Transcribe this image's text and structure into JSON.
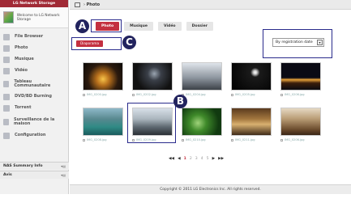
{
  "sidebar": {
    "brand": "LG Network Storage",
    "welcome": "Welcome to LG Network Storage",
    "items": [
      {
        "label": "File Browser",
        "icon": "folder-icon"
      },
      {
        "label": "Photo",
        "icon": "photo-icon"
      },
      {
        "label": "Musique",
        "icon": "music-icon"
      },
      {
        "label": "Vidéo",
        "icon": "video-icon"
      },
      {
        "label": "Tableau Communautaire",
        "icon": "board-icon"
      },
      {
        "label": "DVD/BD Burning",
        "icon": "disc-icon"
      },
      {
        "label": "Torrent",
        "icon": "torrent-icon"
      },
      {
        "label": "Surveillance de la maison",
        "icon": "camera-icon"
      },
      {
        "label": "Configuration",
        "icon": "gear-icon"
      }
    ],
    "nas_summary": "NAS Summary Info",
    "avis": "Avis"
  },
  "topbar": {
    "breadcrumb": "Photo"
  },
  "tabs": [
    {
      "label": "Photo",
      "active": true
    },
    {
      "label": "Musique",
      "active": false
    },
    {
      "label": "Vidéo",
      "active": false
    },
    {
      "label": "Dossier",
      "active": false
    }
  ],
  "slideshow_label": "Diaporama",
  "sort": {
    "selected": "By registration date"
  },
  "annotations": [
    "A",
    "B",
    "C"
  ],
  "photos": [
    {
      "caption": "IMG_0200.jpg",
      "style": "city-night"
    },
    {
      "caption": "IMG_0202.jpg",
      "style": "dark-street"
    },
    {
      "caption": "IMG_0204.jpg",
      "style": "bridge"
    },
    {
      "caption": "IMG_0205.jpg",
      "style": "moon"
    },
    {
      "caption": "IMG_0206.jpg",
      "style": "skyline"
    },
    {
      "caption": "IMG_0208.jpg",
      "style": "river"
    },
    {
      "caption": "IMG_0209.jpg",
      "style": "building"
    },
    {
      "caption": "IMG_0210.jpg",
      "style": "leaf"
    },
    {
      "caption": "IMG_0211.jpg",
      "style": "interior"
    },
    {
      "caption": "IMG_0206.jpg",
      "style": "table"
    }
  ],
  "pager": {
    "pages": [
      "1",
      "2",
      "3",
      "4",
      "5"
    ],
    "current": "1"
  },
  "footer": "Copyright © 2011 LG Electronics Inc. All rights reserved.",
  "colors": {
    "accent": "#c43040",
    "annotation": "#2a2b8c"
  }
}
